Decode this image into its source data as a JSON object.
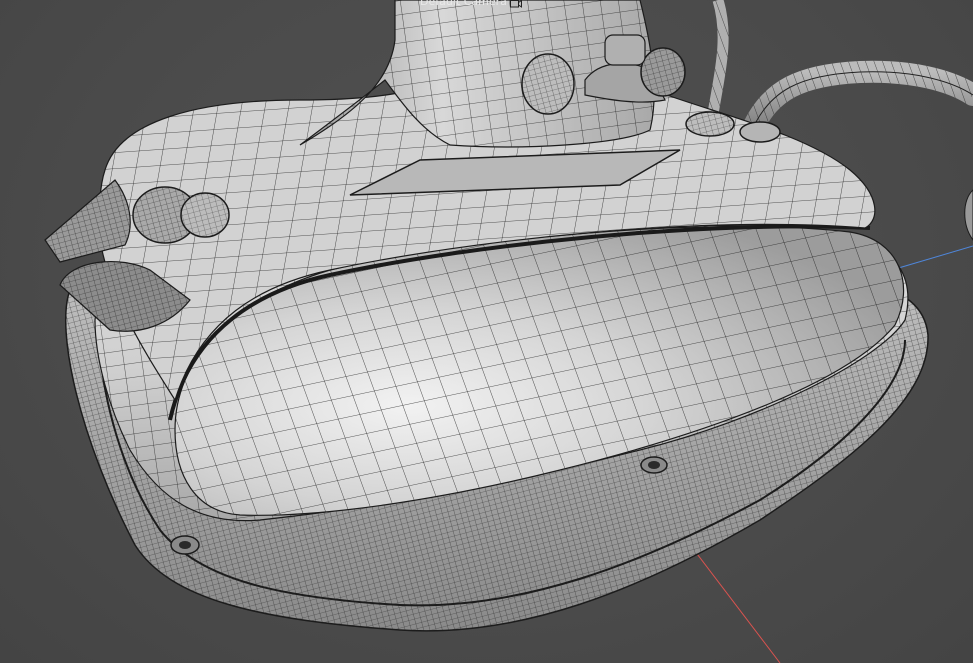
{
  "viewport": {
    "camera_name": "Default Camera",
    "camera_icon": "camera-icon"
  },
  "colors": {
    "background": "#4a4a4a",
    "surface_light": "#e4e4e4",
    "surface_mid": "#c4c4c4",
    "surface_dark": "#8e8e8e",
    "wire": "#1c1c1c",
    "axis_x": "#d9534f",
    "axis_y": "#6cc07a",
    "axis_z": "#4f86d9"
  }
}
